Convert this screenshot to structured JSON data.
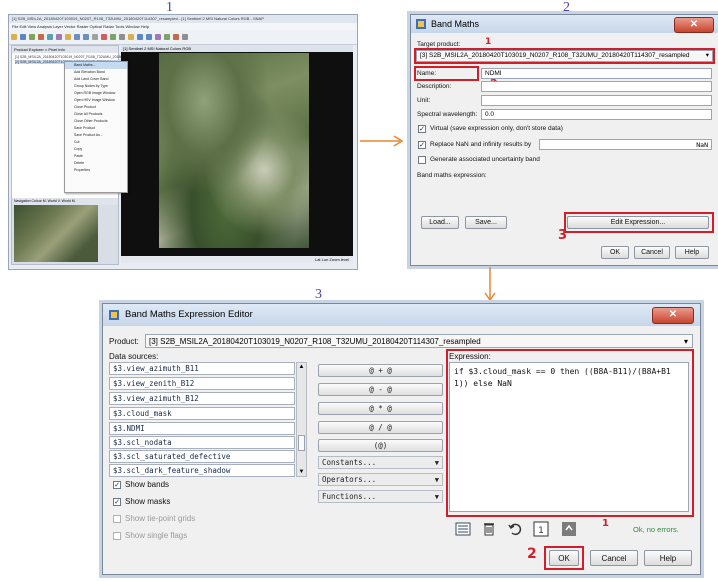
{
  "panel_numbers": {
    "p1": "1",
    "p2": "2",
    "p3": "3"
  },
  "panel1": {
    "title": "[1] S2B_MSIL2A_20180420T103019_N0207_R108_T32UMU_20180420T114307_resampled - [1] Sentinel 2 MSI Natural Colors RGB - SNAP",
    "menu": "File  Edit  View  Analysis  Layer  Vector  Raster  Optical  Radar  Tools  Window  Help",
    "product_explorer_title": "Product Explorer × Pixel Info",
    "products": [
      "[1] S2B_MSIL2A_20180420T103019_N0207_R108_T32UMU_20180420T114307",
      "[2] S2B_MSIL2A_20180420T103019_N0207_R108_T32UMU_resampled"
    ],
    "context_menu": [
      "Band Maths...",
      "Add Elevation Band",
      "Add Land Cover Band",
      "Group Nodes by Type",
      "Open RGB Image Window",
      "Open HSV Image Window",
      "Close Product",
      "Close All Products",
      "Close Other Products",
      "Save Product",
      "Save Product As...",
      "Cut",
      "Copy",
      "Paste",
      "Delete",
      "Properties"
    ],
    "view_tab": "[1] Sentinel 2 MSI Natural Colors RGB",
    "navigation_title": "Navigation  Colour M.  World V.  World M.",
    "status": "Lat   Lon   Zoom level"
  },
  "panel2": {
    "title": "Band Maths",
    "target_product_label": "Target product:",
    "target_product_value": "[3] S2B_MSIL2A_20180420T103019_N0207_R108_T32UMU_20180420T114307_resampled",
    "name_label": "Name:",
    "name_value": "NDMI",
    "description_label": "Description:",
    "unit_label": "Unit:",
    "wavelength_label": "Spectral wavelength:",
    "wavelength_value": "0.0",
    "virtual_label": "Virtual (save expression only, don't store data)",
    "replace_nan_label": "Replace NaN and infinity results by",
    "nan_value": "NaN",
    "uncertainty_label": "Generate associated uncertainty band",
    "expression_label": "Band maths expression:",
    "load_button": "Load...",
    "save_button": "Save...",
    "edit_button": "Edit Expression...",
    "ok_button": "OK",
    "cancel_button": "Cancel",
    "help_button": "Help",
    "markers": {
      "m1": "1",
      "m2": "2",
      "m3": "3"
    }
  },
  "panel3": {
    "title": "Band Maths Expression Editor",
    "product_label": "Product:",
    "product_value": "[3] S2B_MSIL2A_20180420T103019_N0207_R108_T32UMU_20180420T114307_resampled",
    "data_sources_label": "Data sources:",
    "data_sources": [
      "$3.view_azimuth_B11",
      "$3.view_zenith_B12",
      "$3.view_azimuth_B12",
      "$3.cloud_mask",
      "$3.NDMI",
      "$3.scl_nodata",
      "$3.scl_saturated_defective",
      "$3.scl_dark_feature_shadow"
    ],
    "operators": [
      "@ + @",
      "@ - @",
      "@ * @",
      "@ / @",
      "(@)"
    ],
    "dropdowns": [
      "Constants...",
      "Operators...",
      "Functions..."
    ],
    "checkboxes": [
      {
        "label": "Show bands",
        "checked": true,
        "enabled": true
      },
      {
        "label": "Show masks",
        "checked": true,
        "enabled": true
      },
      {
        "label": "Show tie-point grids",
        "checked": false,
        "enabled": false
      },
      {
        "label": "Show single flags",
        "checked": false,
        "enabled": false
      }
    ],
    "expression_label": "Expression:",
    "expression": "if $3.cloud_mask == 0 then ((B8A-B11)/(B8A+B11)) else NaN",
    "status": "Ok, no errors.",
    "ok_button": "OK",
    "cancel_button": "Cancel",
    "help_button": "Help",
    "markers": {
      "m1": "1",
      "m2": "2"
    }
  },
  "colors": {
    "annotation_red": "#d01f2a",
    "arrow_orange": "#e8872e",
    "ok_text_green": "#2e8b3a",
    "number_purple": "#4a3fa0"
  }
}
